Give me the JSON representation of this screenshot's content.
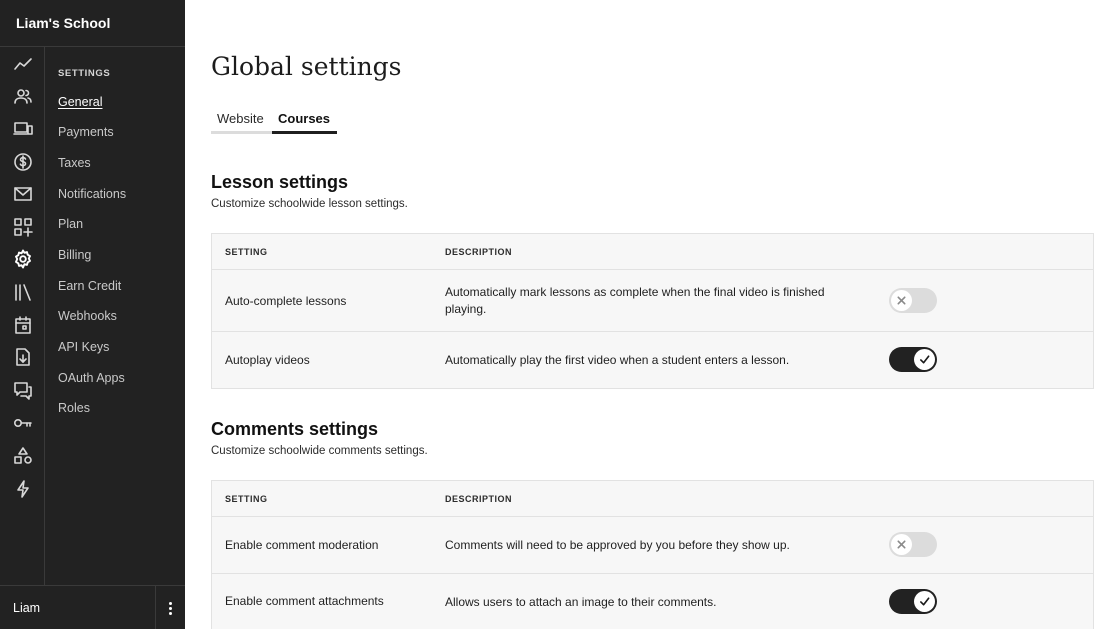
{
  "app": {
    "school_name": "Liam's School"
  },
  "rail_icons": [
    "analytics-icon",
    "users-icon",
    "devices-icon",
    "dollar-icon",
    "mail-icon",
    "apps-add-icon",
    "gear-icon",
    "library-icon",
    "calendar-icon",
    "file-download-icon",
    "chat-icon",
    "key-icon",
    "shapes-icon",
    "lightning-icon"
  ],
  "settings_nav": {
    "title": "SETTINGS",
    "items": [
      {
        "label": "General",
        "active": true
      },
      {
        "label": "Payments"
      },
      {
        "label": "Taxes"
      },
      {
        "label": "Notifications"
      },
      {
        "label": "Plan"
      },
      {
        "label": "Billing"
      },
      {
        "label": "Earn Credit"
      },
      {
        "label": "Webhooks"
      },
      {
        "label": "API Keys"
      },
      {
        "label": "OAuth Apps"
      },
      {
        "label": "Roles"
      }
    ]
  },
  "user": {
    "name": "Liam"
  },
  "page": {
    "title": "Global settings",
    "tabs": [
      {
        "label": "Website",
        "active": false
      },
      {
        "label": "Courses",
        "active": true
      }
    ]
  },
  "lesson": {
    "title": "Lesson settings",
    "subtitle": "Customize schoolwide lesson settings.",
    "col_setting": "SETTING",
    "col_description": "DESCRIPTION",
    "rows": [
      {
        "name": "Auto-complete lessons",
        "description": "Automatically mark lessons as complete when the final video is finished playing.",
        "enabled": false
      },
      {
        "name": "Autoplay videos",
        "description": "Automatically play the first video when a student enters a lesson.",
        "enabled": true
      }
    ]
  },
  "comments": {
    "title": "Comments settings",
    "subtitle": "Customize schoolwide comments settings.",
    "col_setting": "SETTING",
    "col_description": "DESCRIPTION",
    "rows": [
      {
        "name": "Enable comment moderation",
        "description": "Comments will need to be approved by you before they show up.",
        "enabled": false
      },
      {
        "name": "Enable comment attachments",
        "description": "Allows users to attach an image to their comments.",
        "enabled": true
      }
    ]
  }
}
